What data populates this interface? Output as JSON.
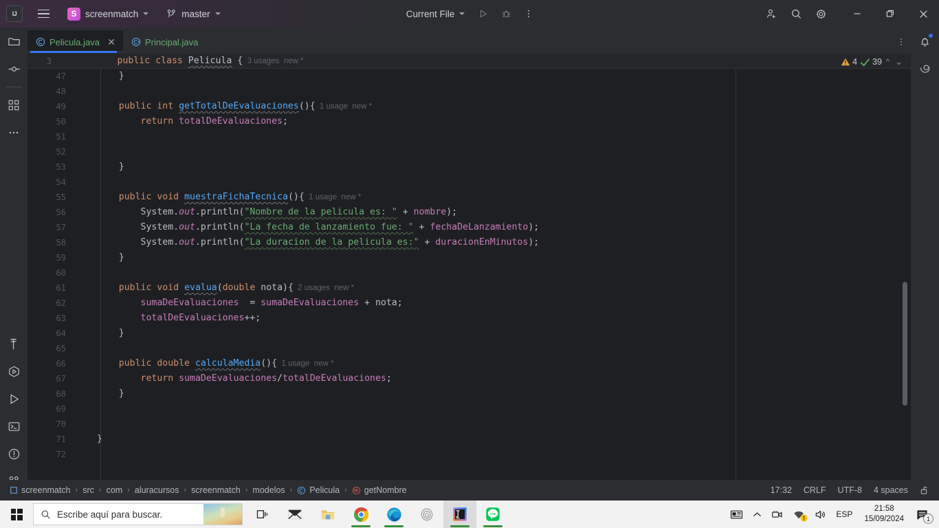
{
  "titlebar": {
    "logo": "IJ",
    "menu_icon": "hamburger-menu-icon",
    "project_initial": "S",
    "project_name": "screenmatch",
    "branch_icon": "git-branch-icon",
    "branch_name": "master",
    "run_config": "Current File",
    "run_icon": "run-icon",
    "debug_icon": "debug-icon",
    "more_icon": "more-vertical-icon",
    "share_icon": "add-user-icon",
    "search_icon": "search-icon",
    "settings_icon": "gear-icon",
    "minimize": "minimize-icon",
    "maximize": "restore-icon",
    "close": "close-icon"
  },
  "left_stripe": {
    "items": [
      {
        "name": "project-tool-window",
        "icon": "folder-icon"
      },
      {
        "name": "commit-tool-window",
        "icon": "commit-icon"
      },
      {
        "name": "plugins-tool-window",
        "icon": "four-squares-icon"
      },
      {
        "name": "more-tool-windows",
        "icon": "ellipsis-icon"
      }
    ],
    "bottom_items": [
      {
        "name": "build-tool-window",
        "icon": "hammer-icon"
      },
      {
        "name": "services-tool-window",
        "icon": "services-icon"
      },
      {
        "name": "run-tool-window",
        "icon": "play-triangle-icon"
      },
      {
        "name": "terminal-tool-window",
        "icon": "terminal-icon"
      },
      {
        "name": "problems-tool-window",
        "icon": "exclamation-circle-icon"
      },
      {
        "name": "git-tool-window",
        "icon": "git-branch-icon"
      }
    ]
  },
  "right_stripe": {
    "items": [
      {
        "name": "notifications-tool-window",
        "icon": "bell-icon",
        "has_badge": true
      },
      {
        "name": "ai-assistant-tool-window",
        "icon": "spiral-icon",
        "has_badge": false
      }
    ]
  },
  "tabs": {
    "items": [
      {
        "label": "Pelicula.java",
        "icon": "java-class-icon",
        "active": true,
        "closable": true
      },
      {
        "label": "Principal.java",
        "icon": "java-runnable-class-icon",
        "active": false,
        "closable": false
      }
    ],
    "close_glyph": "✕",
    "more_icon": "more-vertical-icon"
  },
  "editor": {
    "sticky_line": {
      "number": "3",
      "code_parts": [
        {
          "t": "public",
          "c": "kw"
        },
        {
          "t": " ",
          "c": "pln"
        },
        {
          "t": "class",
          "c": "kw"
        },
        {
          "t": " ",
          "c": "pln"
        },
        {
          "t": "Pelicula",
          "c": "pln-wavy"
        },
        {
          "t": " {",
          "c": "pln"
        }
      ],
      "usages": "3 usages",
      "new_marker": "new *"
    },
    "inspections": {
      "warning_icon": "warning-triangle-icon",
      "warning_count": "4",
      "ok_icon": "checkmark-icon",
      "ok_count": "39",
      "prev_icon": "chevron-up-icon",
      "next_icon": "chevron-down-icon"
    },
    "lines": [
      {
        "n": "47",
        "parts": [
          {
            "t": "    }",
            "c": "punc"
          }
        ]
      },
      {
        "n": "48",
        "parts": []
      },
      {
        "n": "49",
        "parts": [
          {
            "t": "    ",
            "c": "pln"
          },
          {
            "t": "public",
            "c": "kw"
          },
          {
            "t": " ",
            "c": "pln"
          },
          {
            "t": "int",
            "c": "kw"
          },
          {
            "t": " ",
            "c": "pln"
          },
          {
            "t": "getTotalDeEvaluaciones",
            "c": "meth-wavy"
          },
          {
            "t": "(){",
            "c": "punc"
          },
          {
            "t": "  1 usage  new *",
            "c": "hint"
          }
        ]
      },
      {
        "n": "50",
        "parts": [
          {
            "t": "        ",
            "c": "pln"
          },
          {
            "t": "return",
            "c": "kw"
          },
          {
            "t": " ",
            "c": "pln"
          },
          {
            "t": "totalDeEvaluaciones",
            "c": "fld"
          },
          {
            "t": ";",
            "c": "punc"
          }
        ]
      },
      {
        "n": "51",
        "parts": []
      },
      {
        "n": "52",
        "parts": []
      },
      {
        "n": "53",
        "parts": [
          {
            "t": "    }",
            "c": "punc"
          }
        ]
      },
      {
        "n": "54",
        "parts": []
      },
      {
        "n": "55",
        "parts": [
          {
            "t": "    ",
            "c": "pln"
          },
          {
            "t": "public",
            "c": "kw"
          },
          {
            "t": " ",
            "c": "pln"
          },
          {
            "t": "void",
            "c": "kw"
          },
          {
            "t": " ",
            "c": "pln"
          },
          {
            "t": "muestraFichaTecnica",
            "c": "meth-wavy"
          },
          {
            "t": "(){",
            "c": "punc"
          },
          {
            "t": "  1 usage  new *",
            "c": "hint"
          }
        ]
      },
      {
        "n": "56",
        "parts": [
          {
            "t": "        ",
            "c": "pln"
          },
          {
            "t": "System",
            "c": "pln"
          },
          {
            "t": ".",
            "c": "punc"
          },
          {
            "t": "out",
            "c": "ital"
          },
          {
            "t": ".",
            "c": "punc"
          },
          {
            "t": "println",
            "c": "pln"
          },
          {
            "t": "(",
            "c": "punc"
          },
          {
            "t": "\"Nombre de la pelicula es: \"",
            "c": "str-wavy"
          },
          {
            "t": " + ",
            "c": "punc"
          },
          {
            "t": "nombre",
            "c": "fld"
          },
          {
            "t": ");",
            "c": "punc"
          }
        ]
      },
      {
        "n": "57",
        "parts": [
          {
            "t": "        ",
            "c": "pln"
          },
          {
            "t": "System",
            "c": "pln"
          },
          {
            "t": ".",
            "c": "punc"
          },
          {
            "t": "out",
            "c": "ital"
          },
          {
            "t": ".",
            "c": "punc"
          },
          {
            "t": "println",
            "c": "pln"
          },
          {
            "t": "(",
            "c": "punc"
          },
          {
            "t": "\"La fecha de lanzamiento fue: \"",
            "c": "str-wavy"
          },
          {
            "t": " + ",
            "c": "punc"
          },
          {
            "t": "fechaDeLanzamiento",
            "c": "fld"
          },
          {
            "t": ");",
            "c": "punc"
          }
        ]
      },
      {
        "n": "58",
        "parts": [
          {
            "t": "        ",
            "c": "pln"
          },
          {
            "t": "System",
            "c": "pln"
          },
          {
            "t": ".",
            "c": "punc"
          },
          {
            "t": "out",
            "c": "ital"
          },
          {
            "t": ".",
            "c": "punc"
          },
          {
            "t": "println",
            "c": "pln"
          },
          {
            "t": "(",
            "c": "punc"
          },
          {
            "t": "\"La duracion de la pelicula es:\"",
            "c": "str-wavy"
          },
          {
            "t": " + ",
            "c": "punc"
          },
          {
            "t": "duracionEnMinutos",
            "c": "fld"
          },
          {
            "t": ");",
            "c": "punc"
          }
        ]
      },
      {
        "n": "59",
        "parts": [
          {
            "t": "    }",
            "c": "punc"
          }
        ]
      },
      {
        "n": "60",
        "parts": []
      },
      {
        "n": "61",
        "parts": [
          {
            "t": "    ",
            "c": "pln"
          },
          {
            "t": "public",
            "c": "kw"
          },
          {
            "t": " ",
            "c": "pln"
          },
          {
            "t": "void",
            "c": "kw"
          },
          {
            "t": " ",
            "c": "pln"
          },
          {
            "t": "evalua",
            "c": "meth-wavy"
          },
          {
            "t": "(",
            "c": "punc"
          },
          {
            "t": "double",
            "c": "kw"
          },
          {
            "t": " nota){",
            "c": "punc"
          },
          {
            "t": "  2 usages  new *",
            "c": "hint"
          }
        ]
      },
      {
        "n": "62",
        "parts": [
          {
            "t": "        ",
            "c": "pln"
          },
          {
            "t": "sumaDeEvaluaciones",
            "c": "fld"
          },
          {
            "t": "  = ",
            "c": "punc"
          },
          {
            "t": "sumaDeEvaluaciones",
            "c": "fld"
          },
          {
            "t": " + nota;",
            "c": "punc"
          }
        ]
      },
      {
        "n": "63",
        "parts": [
          {
            "t": "        ",
            "c": "pln"
          },
          {
            "t": "totalDeEvaluaciones",
            "c": "fld"
          },
          {
            "t": "++;",
            "c": "punc"
          }
        ]
      },
      {
        "n": "64",
        "parts": [
          {
            "t": "    }",
            "c": "punc"
          }
        ]
      },
      {
        "n": "65",
        "parts": []
      },
      {
        "n": "66",
        "parts": [
          {
            "t": "    ",
            "c": "pln"
          },
          {
            "t": "public",
            "c": "kw"
          },
          {
            "t": " ",
            "c": "pln"
          },
          {
            "t": "double",
            "c": "kw"
          },
          {
            "t": " ",
            "c": "pln"
          },
          {
            "t": "calculaMedia",
            "c": "meth-wavy"
          },
          {
            "t": "(){",
            "c": "punc"
          },
          {
            "t": "  1 usage  new *",
            "c": "hint"
          }
        ]
      },
      {
        "n": "67",
        "parts": [
          {
            "t": "        ",
            "c": "pln"
          },
          {
            "t": "return",
            "c": "kw"
          },
          {
            "t": " ",
            "c": "pln"
          },
          {
            "t": "sumaDeEvaluaciones",
            "c": "fld"
          },
          {
            "t": "/",
            "c": "punc"
          },
          {
            "t": "totalDeEvaluaciones",
            "c": "fld"
          },
          {
            "t": ";",
            "c": "punc"
          }
        ]
      },
      {
        "n": "68",
        "parts": [
          {
            "t": "    }",
            "c": "punc"
          }
        ]
      },
      {
        "n": "69",
        "parts": []
      },
      {
        "n": "70",
        "parts": []
      },
      {
        "n": "71",
        "parts": [
          {
            "t": "}",
            "c": "punc"
          }
        ]
      },
      {
        "n": "72",
        "parts": []
      }
    ]
  },
  "statusbar": {
    "breadcrumb": [
      {
        "label": "screenmatch",
        "icon": "module-icon"
      },
      {
        "label": "src",
        "icon": null
      },
      {
        "label": "com",
        "icon": null
      },
      {
        "label": "aluracursos",
        "icon": null
      },
      {
        "label": "screenmatch",
        "icon": null
      },
      {
        "label": "modelos",
        "icon": null
      },
      {
        "label": "Pelicula",
        "icon": "java-class-icon"
      },
      {
        "label": "getNombre",
        "icon": "java-method-icon"
      }
    ],
    "separator": "›",
    "caret_position": "17:32",
    "line_separator": "CRLF",
    "encoding": "UTF-8",
    "indent": "4 spaces",
    "lock_icon": "unlocked-padlock-icon"
  },
  "taskbar": {
    "start_icon": "windows-logo-icon",
    "search_placeholder": "Escribe aquí para buscar.",
    "search_icon": "search-icon",
    "apps": [
      {
        "name": "task-view",
        "icon": "task-view-icon",
        "running": false,
        "active": false
      },
      {
        "name": "mail",
        "icon": "mail-icon",
        "running": false,
        "active": false
      },
      {
        "name": "file-explorer",
        "icon": "folder-icon",
        "running": false,
        "active": false
      },
      {
        "name": "google-chrome",
        "icon": "chrome-icon",
        "running": true,
        "active": false
      },
      {
        "name": "microsoft-edge",
        "icon": "edge-icon",
        "running": true,
        "active": false
      },
      {
        "name": "ring-app",
        "icon": "ring-icon",
        "running": false,
        "active": false
      },
      {
        "name": "intellij-idea",
        "icon": "intellij-icon",
        "running": true,
        "active": true
      },
      {
        "name": "line",
        "icon": "line-icon",
        "running": true,
        "active": false
      }
    ],
    "tray": {
      "news_icon": "news-widget-icon",
      "chevron_icon": "show-hidden-icons-icon",
      "camera_icon": "camera-icon",
      "network_icon": "network-warning-icon",
      "volume_icon": "volume-icon",
      "language": "ESP",
      "time": "21:58",
      "date": "15/09/2024",
      "notifications_icon": "notification-icon",
      "notifications_count": "1"
    }
  }
}
